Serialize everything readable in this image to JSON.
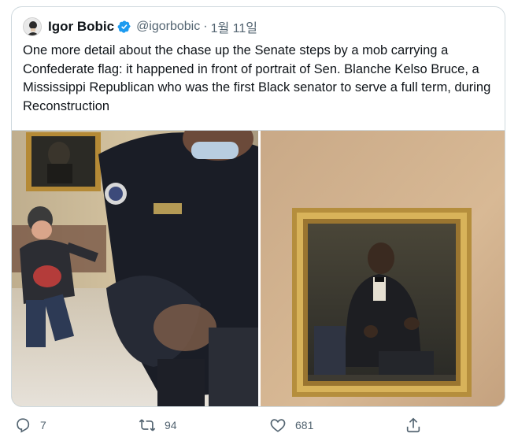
{
  "tweet": {
    "author_name": "Igor Bobic",
    "handle": "@igorbobic",
    "separator": "·",
    "date": "1월 11일",
    "text": "One more detail about the chase up the Senate steps by a mob carrying a Confederate flag: it happened in front of portrait of Sen. Blanche Kelso Bruce, a Mississippi Republican who was the first Black senator to serve a full term, during Reconstruction"
  },
  "media": [
    {
      "icon": "photo-chase-on-steps"
    },
    {
      "icon": "photo-portrait-blanche-kelso-bruce"
    }
  ],
  "actions": {
    "replies": "7",
    "retweets": "94",
    "likes": "681"
  },
  "colors": {
    "text": "#0f1419",
    "muted": "#536471",
    "verified": "#1d9bf0",
    "border": "#cfd9de"
  }
}
